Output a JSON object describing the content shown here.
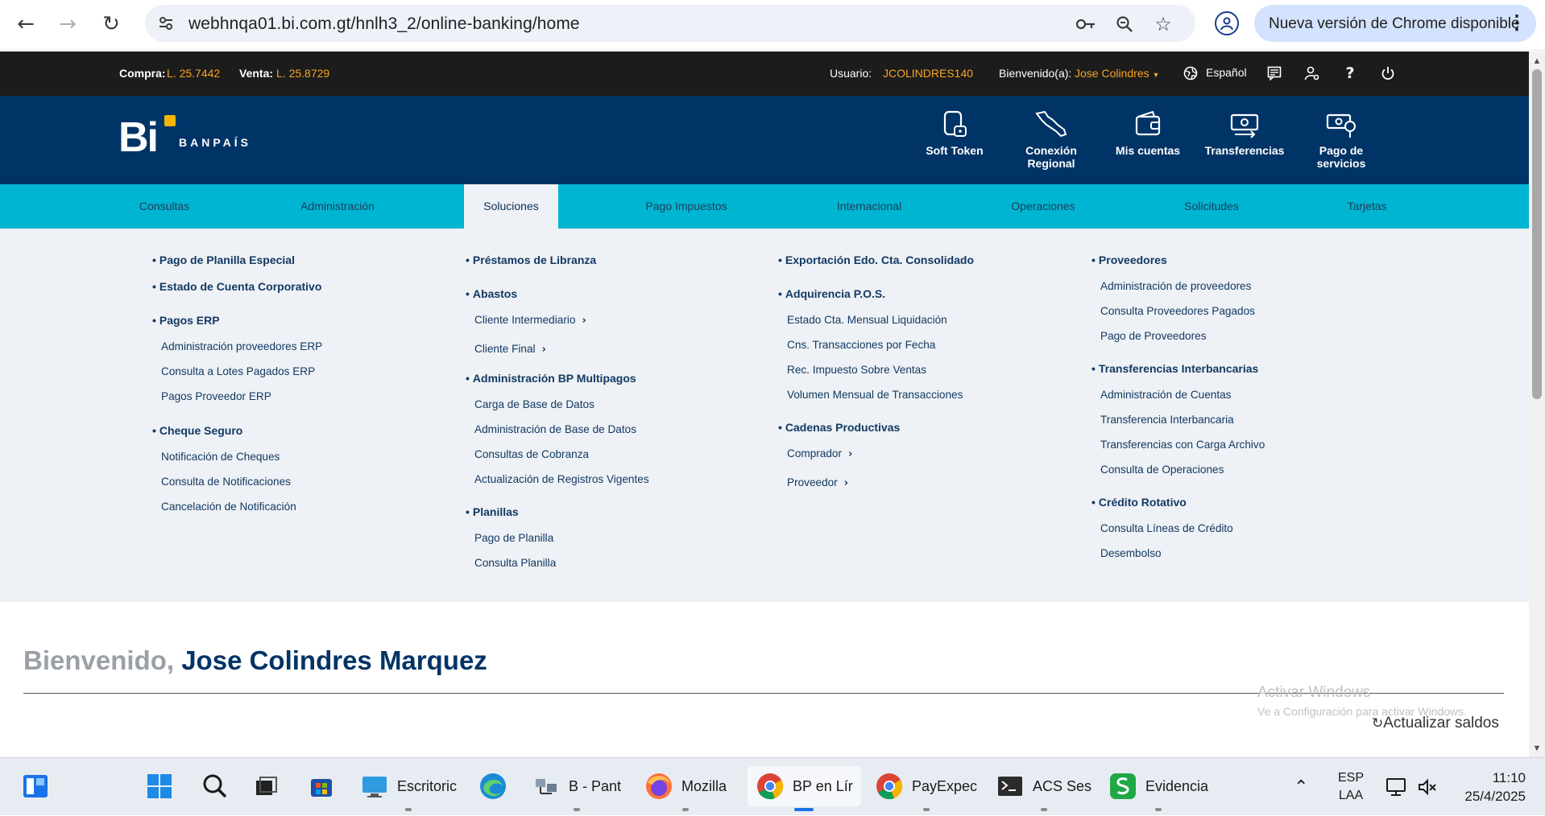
{
  "browser": {
    "url": "webhnqa01.bi.com.gt/hnlh3_2/online-banking/home",
    "update_label": "Nueva versión de Chrome disponible"
  },
  "topbar": {
    "compra_label": "Compra:",
    "compra_value": "L. 25.7442",
    "venta_label": "Venta:",
    "venta_value": "L. 25.8729",
    "usuario_label": "Usuario:",
    "usuario_value": "JCOLINDRES140",
    "bienvenido_label": "Bienvenido(a):",
    "bienvenido_value": "Jose Colindres",
    "language": "Español"
  },
  "header": {
    "brand": "BANPAÍS",
    "quick_actions": [
      {
        "label": "Soft Token",
        "icon": "phone-token-icon"
      },
      {
        "label": "Conexión Regional",
        "icon": "region-map-icon"
      },
      {
        "label": "Mis cuentas",
        "icon": "wallet-icon"
      },
      {
        "label": "Transferencias",
        "icon": "money-transfer-icon"
      },
      {
        "label": "Pago de servicios",
        "icon": "service-payment-icon"
      }
    ]
  },
  "menu": {
    "items": [
      "Consultas",
      "Administración",
      "Soluciones",
      "Pago Impuestos",
      "Internacional",
      "Operaciones",
      "Solicitudes",
      "Tarjetas"
    ],
    "active": "Soluciones"
  },
  "dropdown": {
    "col1": {
      "h1": "Pago de Planilla Especial",
      "h2": "Estado de Cuenta Corporativo",
      "h3": "Pagos ERP",
      "h3_items": [
        "Administración proveedores ERP",
        "Consulta a Lotes Pagados ERP",
        "Pagos Proveedor ERP"
      ],
      "h4": "Cheque Seguro",
      "h4_items": [
        "Notificación de Cheques",
        "Consulta de Notificaciones",
        "Cancelación de Notificación"
      ]
    },
    "col2": {
      "h1": "Préstamos de Libranza",
      "h2": "Abastos",
      "h2_items": [
        "Cliente Intermediario",
        "Cliente Final"
      ],
      "h3": "Administración BP Multipagos",
      "h3_items": [
        "Carga de Base de Datos",
        "Administración de Base de Datos",
        "Consultas de Cobranza",
        "Actualización de Registros Vigentes"
      ],
      "h4": "Planillas",
      "h4_items": [
        "Pago de Planilla",
        "Consulta Planilla"
      ]
    },
    "col3": {
      "h1": "Exportación Edo. Cta. Consolidado",
      "h2": "Adquirencia P.O.S.",
      "h2_items": [
        "Estado Cta. Mensual Liquidación",
        "Cns. Transacciones por Fecha",
        "Rec. Impuesto Sobre Ventas",
        "Volumen Mensual de Transacciones"
      ],
      "h3": "Cadenas Productivas",
      "h3_items": [
        "Comprador",
        "Proveedor"
      ]
    },
    "col4": {
      "h1": "Proveedores",
      "h1_items": [
        "Administración de proveedores",
        "Consulta Proveedores Pagados",
        "Pago de Proveedores"
      ],
      "h2": "Transferencias Interbancarias",
      "h2_items": [
        "Administración de Cuentas",
        "Transferencia Interbancaria",
        "Transferencias con Carga Archivo",
        "Consulta de Operaciones"
      ],
      "h3": "Crédito Rotativo",
      "h3_items": [
        "Consulta Líneas de Crédito",
        "Desembolso"
      ]
    }
  },
  "main": {
    "welcome_prefix": "Bienvenido,",
    "welcome_name": "Jose Colindres Marquez",
    "refresh_label": "Actualizar saldos",
    "watermark_line1": "Activar Windows",
    "watermark_line2": "Ve a Configuración para activar Windows."
  },
  "taskbar": {
    "apps": [
      {
        "label": "Escritoric"
      },
      {
        "label": "B - Pant"
      },
      {
        "label": "Mozilla"
      },
      {
        "label": "BP en Lír"
      },
      {
        "label": "PayExpec"
      },
      {
        "label": "ACS Ses"
      },
      {
        "label": "Evidencia"
      }
    ],
    "lang_top": "ESP",
    "lang_bottom": "LAA",
    "time": "11:10",
    "date": "25/4/2025"
  }
}
